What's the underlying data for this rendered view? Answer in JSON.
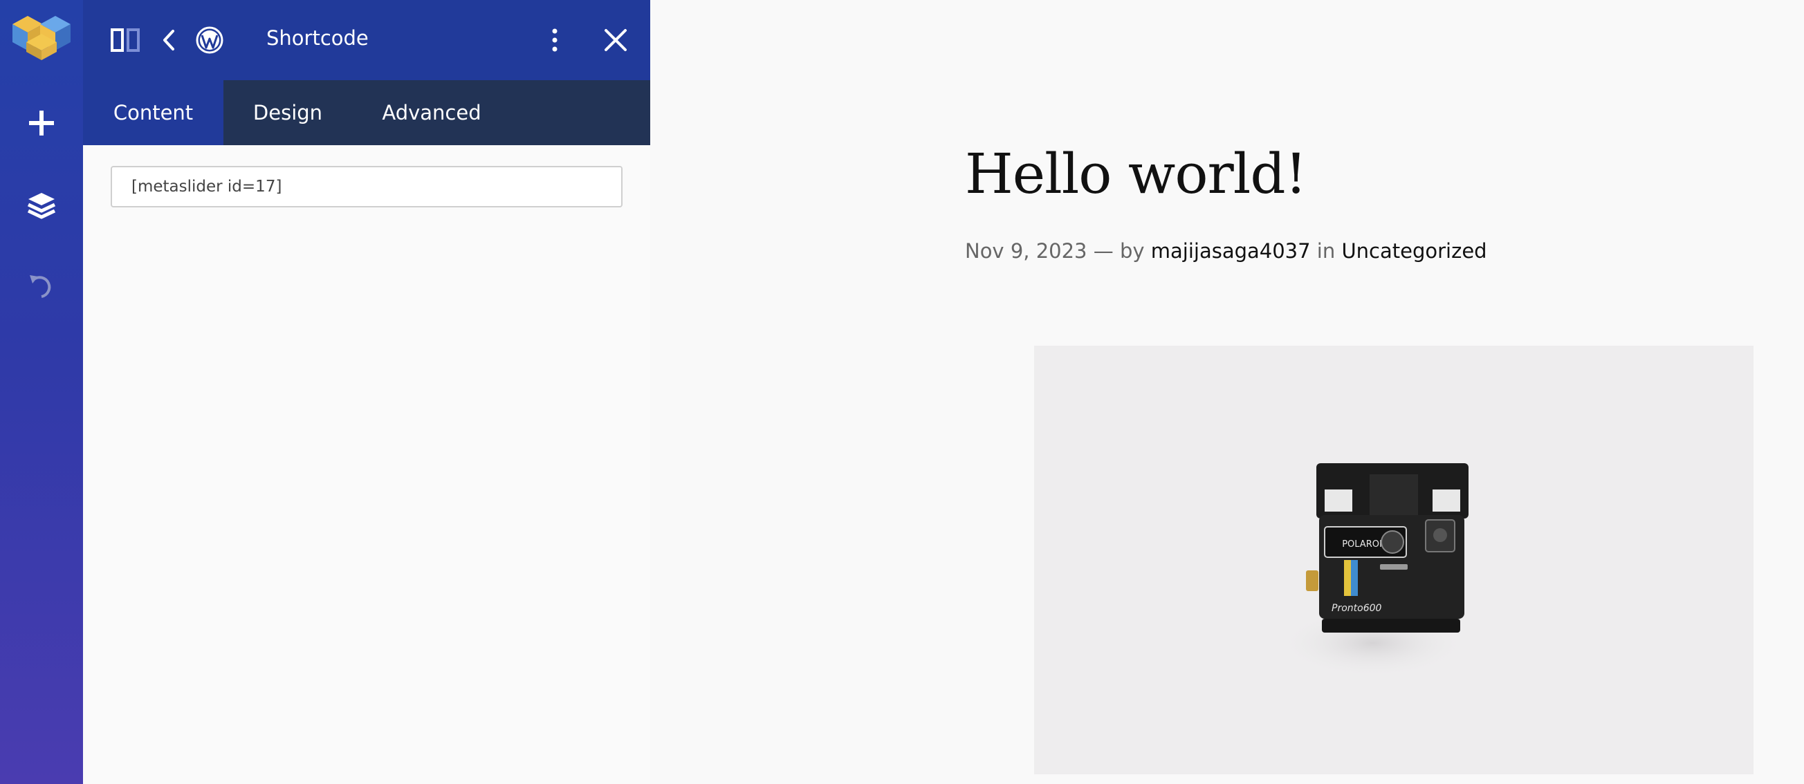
{
  "panel": {
    "title": "Shortcode",
    "tabs": [
      {
        "label": "Content",
        "active": true
      },
      {
        "label": "Design",
        "active": false
      },
      {
        "label": "Advanced",
        "active": false
      }
    ],
    "shortcode": {
      "value": "[metaslider id=17]"
    }
  },
  "rail": {
    "icons": [
      "builder-logo-icon",
      "add-icon",
      "layers-icon",
      "undo-icon"
    ]
  },
  "header_icons": [
    "panel-toggle-icon",
    "back-chevron-icon",
    "wordpress-icon",
    "more-vertical-icon",
    "close-icon"
  ],
  "post": {
    "title": "Hello world!",
    "date": "Nov 9, 2023",
    "separator": "—",
    "by": "by",
    "author": "majijasaga4037",
    "in": "in",
    "category": "Uncategorized"
  },
  "image": {
    "camera_brand": "POLAROID",
    "camera_model": "Pronto600"
  },
  "colors": {
    "rail_top": "#2440a8",
    "rail_bottom": "#4a3cb0",
    "header": "#213a9a",
    "tabs_bar": "#223355",
    "page_bg": "#f9f9f9"
  }
}
